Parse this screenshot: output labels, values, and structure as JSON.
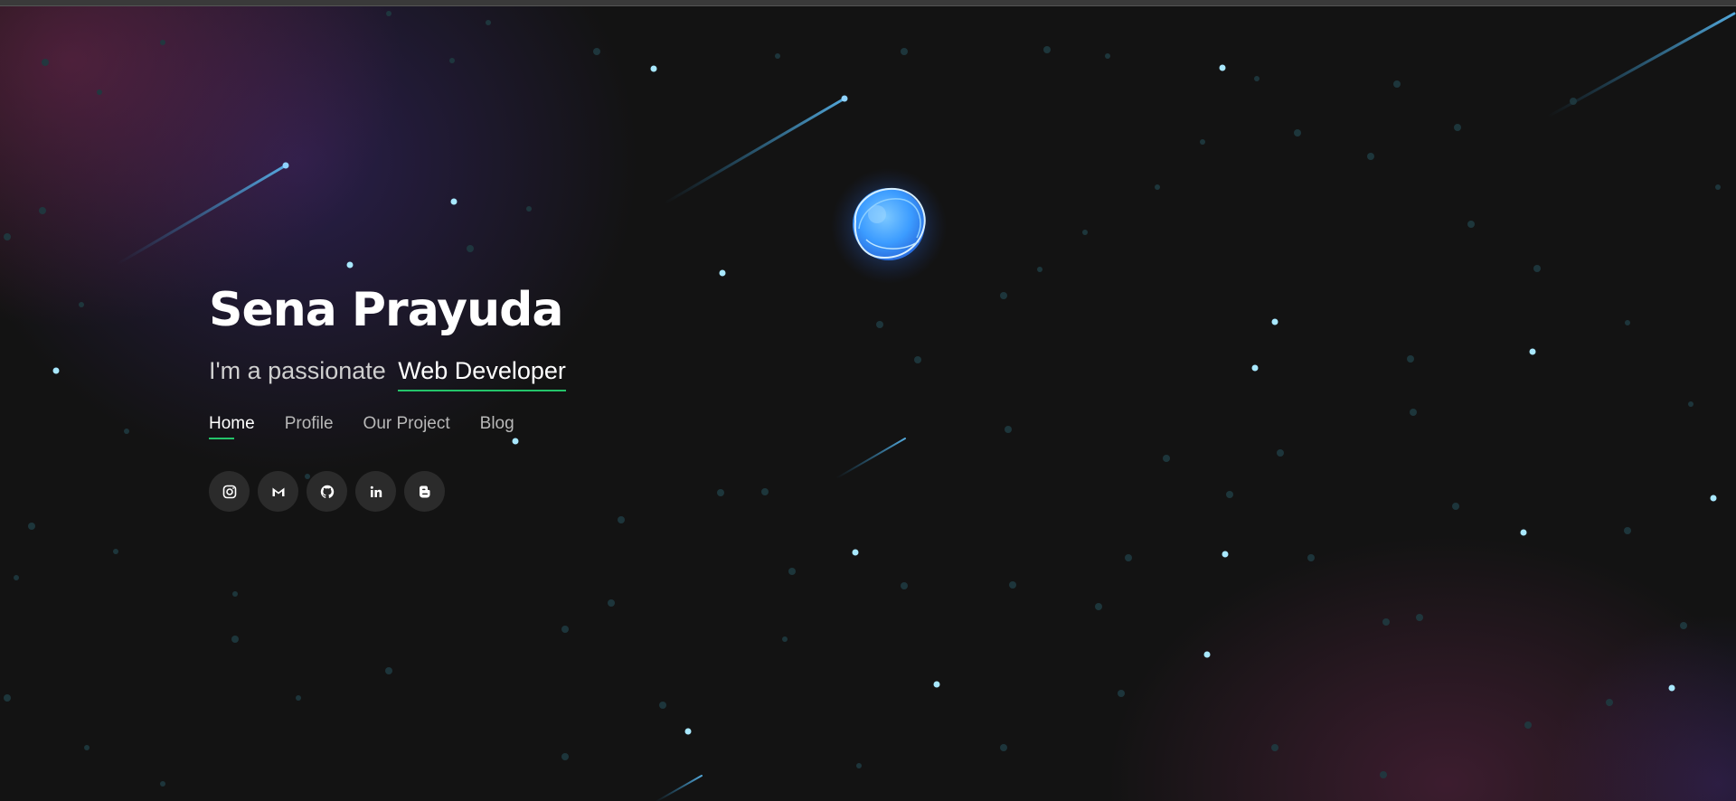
{
  "hero": {
    "name": "Sena Prayuda",
    "tagline_prefix": "I'm a passionate",
    "tagline_role": "Web Developer"
  },
  "nav": {
    "items": [
      {
        "label": "Home",
        "active": true
      },
      {
        "label": "Profile",
        "active": false
      },
      {
        "label": "Our Project",
        "active": false
      },
      {
        "label": "Blog",
        "active": false
      }
    ]
  },
  "socials": [
    {
      "icon": "instagram-icon"
    },
    {
      "icon": "gmail-icon"
    },
    {
      "icon": "github-icon"
    },
    {
      "icon": "linkedin-icon"
    },
    {
      "icon": "blogger-icon"
    }
  ],
  "colors": {
    "background": "#131313",
    "accent": "#24c46a",
    "star": "#a8e8ff",
    "planet": "#4aa6ff",
    "social_bg": "#2b2b2b"
  }
}
